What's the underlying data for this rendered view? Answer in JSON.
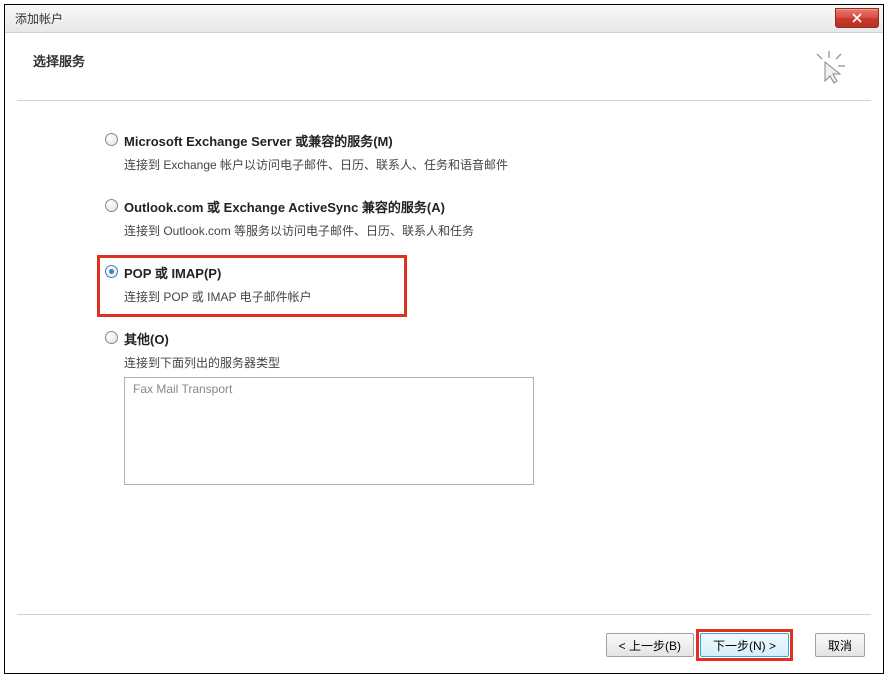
{
  "window": {
    "title": "添加帐户"
  },
  "header": {
    "title": "选择服务"
  },
  "options": [
    {
      "id": "exchange",
      "label": "Microsoft Exchange Server 或兼容的服务(M)",
      "desc": "连接到 Exchange 帐户以访问电子邮件、日历、联系人、任务和语音邮件",
      "selected": false,
      "highlighted": false
    },
    {
      "id": "outlook",
      "label": "Outlook.com 或 Exchange ActiveSync 兼容的服务(A)",
      "desc": "连接到 Outlook.com 等服务以访问电子邮件、日历、联系人和任务",
      "selected": false,
      "highlighted": false
    },
    {
      "id": "pop-imap",
      "label": "POP 或 IMAP(P)",
      "desc": "连接到 POP 或 IMAP 电子邮件帐户",
      "selected": true,
      "highlighted": true
    },
    {
      "id": "other",
      "label": "其他(O)",
      "desc": "连接到下面列出的服务器类型",
      "selected": false,
      "highlighted": false,
      "hasListbox": true
    }
  ],
  "listbox": {
    "items": [
      "Fax Mail Transport"
    ]
  },
  "footer": {
    "back": "< 上一步(B)",
    "next": "下一步(N) >",
    "cancel": "取消"
  }
}
